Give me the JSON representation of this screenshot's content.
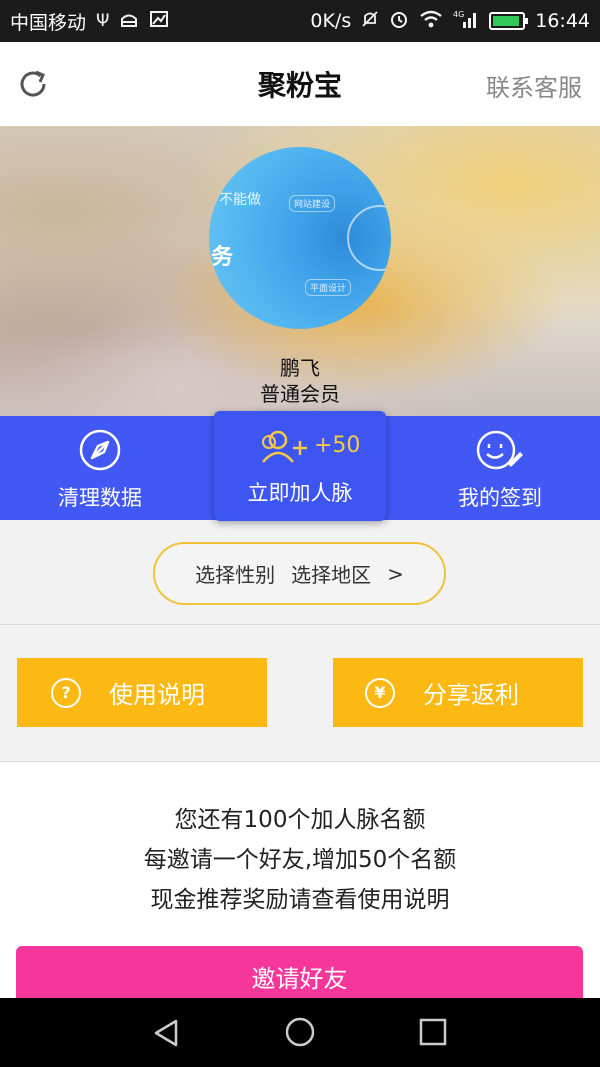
{
  "status_bar": {
    "carrier": "中国移动",
    "speed": "0K/s",
    "network": "4G",
    "time": "16:44"
  },
  "header": {
    "title": "聚粉宝",
    "support_label": "联系客服"
  },
  "profile": {
    "name": "鹏飞",
    "level": "普通会员",
    "avatar_text_1": "不能做",
    "avatar_text_2": "务",
    "avatar_tag_1": "网站建设",
    "avatar_tag_2": "平面设计"
  },
  "actions": {
    "clean": "清理数据",
    "join": "立即加人脉",
    "join_bonus": "+50",
    "signin": "我的签到"
  },
  "filter": {
    "gender": "选择性别",
    "region": "选择地区",
    "arrow": ">"
  },
  "buttons": {
    "help": "使用说明",
    "share": "分享返利"
  },
  "info": {
    "line1": "您还有100个加人脉名额",
    "line2": "每邀请一个好友,增加50个名额",
    "line3": "现金推荐奖励请查看使用说明"
  },
  "invite_label": "邀请好友",
  "colors": {
    "action_bar": "#4158f4",
    "yellow_button": "#fdb913",
    "invite_button": "#f6369b",
    "filter_border": "#f0c23a"
  }
}
